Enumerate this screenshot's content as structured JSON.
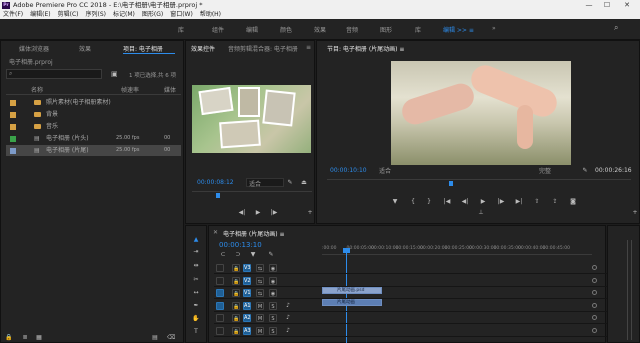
{
  "window": {
    "title": "Adobe Premiere Pro CC 2018 - E:\\电子相册\\电子相册.prproj *",
    "logo": "Pr",
    "min": "—",
    "max": "☐",
    "close": "✕"
  },
  "menu": [
    "文件(F)",
    "编辑(E)",
    "剪辑(C)",
    "序列(S)",
    "标记(M)",
    "图形(G)",
    "窗口(W)",
    "帮助(H)"
  ],
  "workspaces": [
    "库",
    "组件",
    "编辑",
    "颜色",
    "效果",
    "音频",
    "图形",
    "库",
    "编辑 >> ≡",
    "»"
  ],
  "active_workspace": "编辑 >> ≡",
  "project": {
    "tabs": [
      "媒体浏览器",
      "效果",
      "项目: 电子相册"
    ],
    "active_tab": "项目: 电子相册",
    "path": "电子相册.prproj",
    "search_placeholder": "",
    "count": "1 项已选择,共 6 项",
    "col_name": "名称",
    "col_rate": "帧速率",
    "col_media": "媒体",
    "rows": [
      {
        "name": "照片素材(电子相册素材)",
        "kind": "folder",
        "color": "#d6a144",
        "rate": "",
        "dur": ""
      },
      {
        "name": "背景",
        "kind": "folder",
        "color": "#d6a144",
        "rate": "",
        "dur": ""
      },
      {
        "name": "音乐",
        "kind": "folder",
        "color": "#d6a144",
        "rate": "",
        "dur": ""
      },
      {
        "name": "电子相册 (片头)",
        "kind": "seq",
        "color": "#3aa34a",
        "rate": "25.00 fps",
        "dur": "00"
      },
      {
        "name": "电子相册 (片尾)",
        "kind": "seq",
        "color": "#7d9bc9",
        "rate": "25.00 fps",
        "dur": "00"
      }
    ]
  },
  "source": {
    "tabs": [
      "效果控件",
      "音频剪辑混合器: 电子相册",
      "≡"
    ],
    "time": "00:00:08:12",
    "zoom": "适合",
    "res": "完整"
  },
  "program": {
    "tab": "节目: 电子相册 (片尾动画) ≡",
    "time": "00:00:10:10",
    "fit": "适合",
    "quality": "完整",
    "duration": "00:00:26:16"
  },
  "timeline": {
    "tab": "电子相册 (片尾动画) ≡",
    "time": "00:00:13:10",
    "ruler": [
      ":00:00",
      "00:00:05:00",
      "00:00:10:00",
      "00:00:15:00",
      "00:00:20:00",
      "00:00:25:00",
      "00:00:30:00",
      "00:00:35:00",
      "00:00:40:00",
      "00:00:45:00"
    ],
    "tracks": [
      "V3",
      "V2",
      "V1",
      "A1",
      "A2",
      "A3"
    ],
    "clip1": "片尾动画.psd",
    "clip2": "片尾动画"
  },
  "colors": {
    "accent": "#2d8ceb",
    "folder": "#d6a144",
    "green": "#3aa34a"
  }
}
